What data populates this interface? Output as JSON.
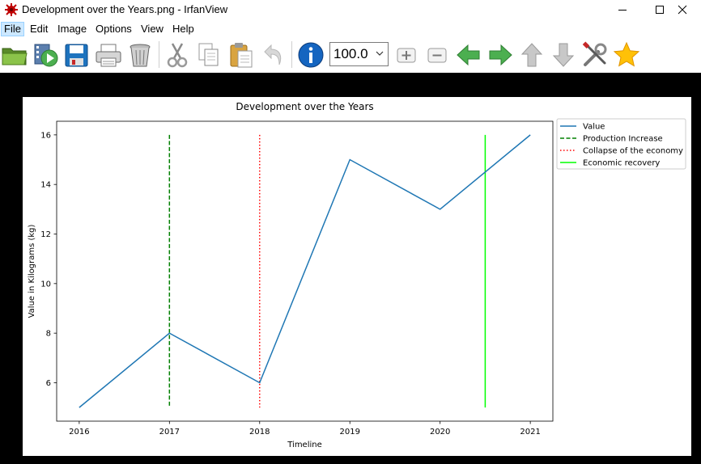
{
  "window": {
    "title": "Development over the Years.png - IrfanView"
  },
  "menu": [
    {
      "label": "File",
      "name": "menu-file",
      "active": true
    },
    {
      "label": "Edit",
      "name": "menu-edit"
    },
    {
      "label": "Image",
      "name": "menu-image"
    },
    {
      "label": "Options",
      "name": "menu-options"
    },
    {
      "label": "View",
      "name": "menu-view"
    },
    {
      "label": "Help",
      "name": "menu-help"
    }
  ],
  "toolbar": {
    "zoom_value": "100.0",
    "buttons": [
      "open-icon",
      "slideshow-icon",
      "save-icon",
      "print-icon",
      "delete-icon",
      "cut-icon",
      "copy-icon",
      "paste-icon",
      "undo-icon",
      "info-icon",
      "zoom-in-icon",
      "zoom-out-icon",
      "previous-icon",
      "next-icon",
      "first-icon",
      "last-icon",
      "settings-icon",
      "favorites-icon"
    ]
  },
  "chart_data": {
    "type": "line",
    "title": "Development over the Years",
    "xlabel": "Timeline",
    "ylabel": "Value in Kilograms (kg)",
    "x": [
      2016,
      2017,
      2018,
      2019,
      2020,
      2021
    ],
    "series": [
      {
        "name": "Value",
        "values": [
          5,
          8,
          6,
          15,
          13,
          16
        ],
        "color": "#1f77b4",
        "style": "solid"
      }
    ],
    "vlines": [
      {
        "name": "Production Increase",
        "x": 2017,
        "ymin": 5,
        "ymax": 16,
        "color": "#008000",
        "style": "dashed"
      },
      {
        "name": "Collapse of the economy",
        "x": 2018,
        "ymin": 5,
        "ymax": 16,
        "color": "#ff0000",
        "style": "dotted"
      },
      {
        "name": "Economic recovery",
        "x": 2020.5,
        "ymin": 5,
        "ymax": 16,
        "color": "#00ff00",
        "style": "solid"
      }
    ],
    "xticks": [
      "2016",
      "2017",
      "2018",
      "2019",
      "2020",
      "2021"
    ],
    "yticks": [
      "6",
      "8",
      "10",
      "12",
      "14",
      "16"
    ],
    "xlim": [
      2015.75,
      2021.25
    ],
    "ylim": [
      4.45,
      16.55
    ],
    "grid": false,
    "legend_position": "outside-upper-right"
  }
}
